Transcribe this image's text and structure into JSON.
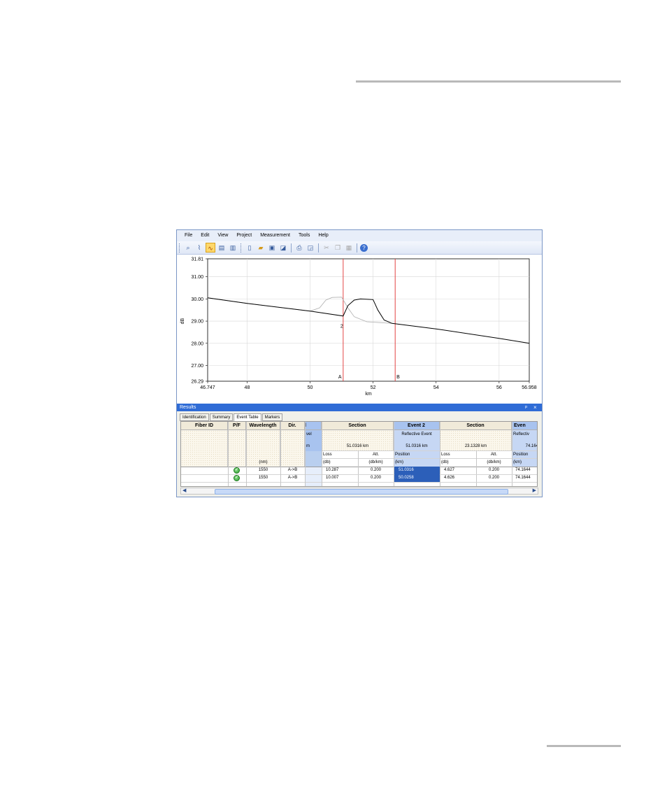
{
  "menu": [
    "File",
    "Edit",
    "View",
    "Project",
    "Measurement",
    "Tools",
    "Help"
  ],
  "toolbar_icons": [
    "zoom-icon",
    "trace-icon",
    "trace-active-icon",
    "page-icon",
    "page2-icon",
    "new-icon",
    "open-icon",
    "save-icon",
    "save-all-icon",
    "print-icon",
    "print-preview-icon",
    "cut-icon",
    "copy-icon",
    "paste-icon",
    "help-icon"
  ],
  "chart_data": {
    "type": "line",
    "xlabel": "km",
    "ylabel": "dB",
    "xlim": [
      46.747,
      56.958
    ],
    "ylim": [
      26.29,
      31.81
    ],
    "x_ticks": [
      "46.747",
      "48",
      "50",
      "52",
      "54",
      "56",
      "56.958"
    ],
    "y_ticks": [
      "31.81",
      "31.00",
      "30.00",
      "29.00",
      "28.00",
      "27.00",
      "26.29"
    ],
    "grid": true,
    "series": [
      {
        "x": [
          46.747,
          48,
          50,
          51.05,
          51.2,
          51.4,
          51.6,
          52.0,
          52.15,
          52.35,
          52.6,
          54,
          56,
          56.958
        ],
        "y": [
          30.05,
          29.8,
          29.45,
          29.23,
          29.7,
          29.95,
          30.0,
          29.97,
          29.5,
          29.05,
          28.9,
          28.65,
          28.22,
          28.0
        ],
        "color": "#000000"
      },
      {
        "x": [
          46.747,
          48,
          50,
          50.3,
          50.5,
          50.7,
          51.0,
          51.2,
          51.4,
          51.8,
          52.6
        ],
        "y": [
          30.05,
          29.8,
          29.45,
          29.6,
          29.95,
          30.07,
          30.08,
          29.6,
          29.2,
          28.97,
          28.9
        ],
        "color": "#b0b0b0"
      }
    ],
    "markers": [
      {
        "label": "A",
        "x": 51.05,
        "color": "#e03030"
      },
      {
        "label": "B",
        "x": 52.7,
        "color": "#e03030"
      }
    ],
    "annotations": [
      {
        "text": "2",
        "x": 51.05,
        "y": 28.9
      }
    ]
  },
  "results": {
    "title": "Results",
    "pin": "ᵖ",
    "close": "×",
    "tabs": [
      "Identification",
      "Summary",
      "Event Table",
      "Markers"
    ],
    "selected_tab": "Event Table",
    "headers": {
      "fiber_id": "Fiber ID",
      "pf": "P/F",
      "wavelength": "Wavelength",
      "dir": "Dir.",
      "partial": "l",
      "section1": "Section",
      "event2": "Event 2",
      "section2": "Section",
      "event3": "Even"
    },
    "subrow1": {
      "partial": "vel",
      "event2": "Reflective Event",
      "event3": "Reflectiv"
    },
    "subrow2": {
      "partial": "m",
      "section1": "51.0316 km",
      "event2": "51.0316 km",
      "section2": "23.1328 km",
      "event3": "74.164"
    },
    "subrow3": {
      "loss": "Loss",
      "att": "Att.",
      "position": "Position"
    },
    "subrow4": {
      "wl_unit": "(nm)",
      "db": "(db)",
      "dbkm": "(db/km)",
      "km": "(km)"
    },
    "rows": [
      {
        "wavelength": "1550",
        "dir": "A->B",
        "loss1": "10.287",
        "att1": "0.200",
        "pos2": "51.0316",
        "loss2": "4.627",
        "att2": "0.200",
        "pos3": "74.1644"
      },
      {
        "wavelength": "1550",
        "dir": "A->B",
        "loss1": "10.007",
        "att1": "0.200",
        "pos2": "50.0258",
        "loss2": "4.626",
        "att2": "0.200",
        "pos3": "74.1644"
      }
    ]
  }
}
